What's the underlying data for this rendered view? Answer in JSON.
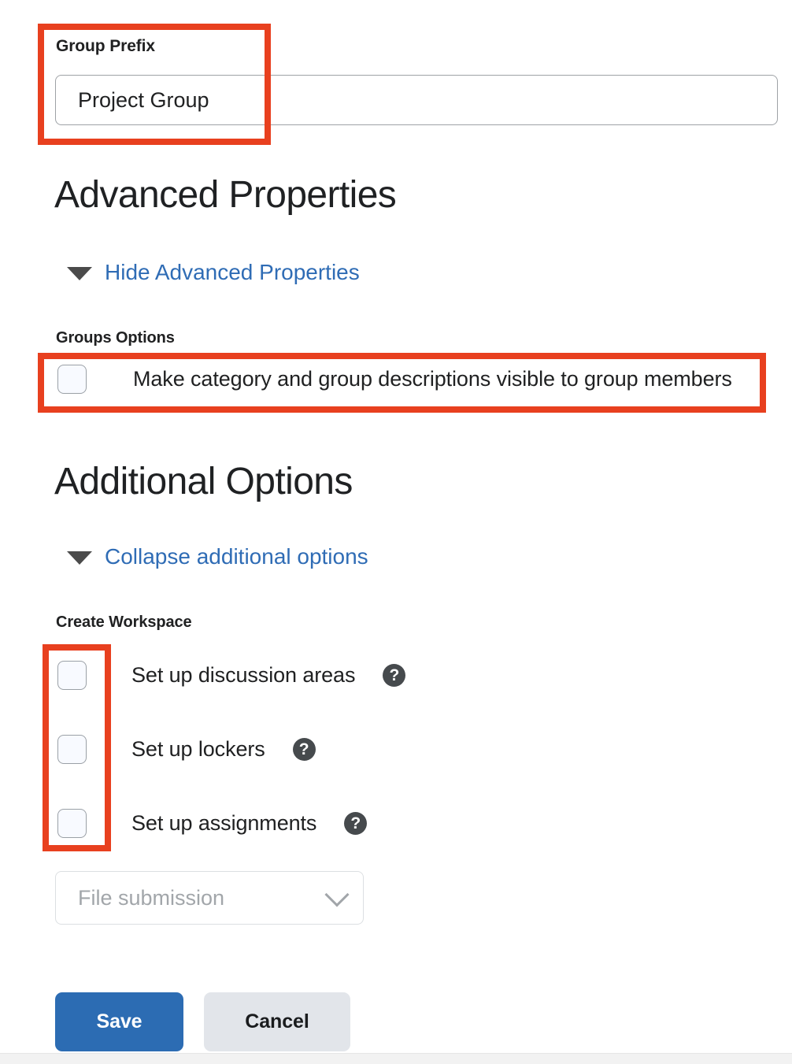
{
  "form": {
    "group_prefix": {
      "label": "Group Prefix",
      "value": "Project Group",
      "placeholder": ""
    },
    "advanced_properties": {
      "heading": "Advanced Properties",
      "disclosure_label": "Hide Advanced Properties",
      "disclosure_icon": "caret-down-icon",
      "groups_options_label": "Groups Options",
      "descriptions_checkbox": {
        "label": "Make category and group descriptions visible to group members",
        "checked": false
      }
    },
    "additional_options": {
      "heading": "Additional Options",
      "disclosure_label": "Collapse additional options",
      "disclosure_icon": "caret-down-icon",
      "create_workspace_label": "Create Workspace",
      "workspace_checkboxes": [
        {
          "label": "Set up discussion areas",
          "checked": false,
          "help_icon": "question-mark-icon",
          "help_glyph": "?"
        },
        {
          "label": "Set up lockers",
          "checked": false,
          "help_icon": "question-mark-icon",
          "help_glyph": "?"
        },
        {
          "label": "Set up assignments",
          "checked": false,
          "help_icon": "question-mark-icon",
          "help_glyph": "?"
        }
      ],
      "submission_type": {
        "selected": "File submission",
        "disabled": true,
        "chevron_icon": "chevron-down-icon"
      }
    }
  },
  "actions": {
    "save_label": "Save",
    "cancel_label": "Cancel"
  },
  "annotations": {
    "color": "#e8401f",
    "boxes": [
      {
        "name": "group-prefix-highlight"
      },
      {
        "name": "descriptions-checkbox-highlight"
      },
      {
        "name": "workspace-checkboxes-highlight"
      }
    ]
  },
  "colors": {
    "link": "#2f6cb5",
    "primary_button": "#2c6cb3",
    "secondary_button": "#e2e5ea",
    "annotation_red": "#e8401f",
    "help_icon": "#464a4d",
    "text": "#202122",
    "muted_text": "#a2a6aa"
  }
}
